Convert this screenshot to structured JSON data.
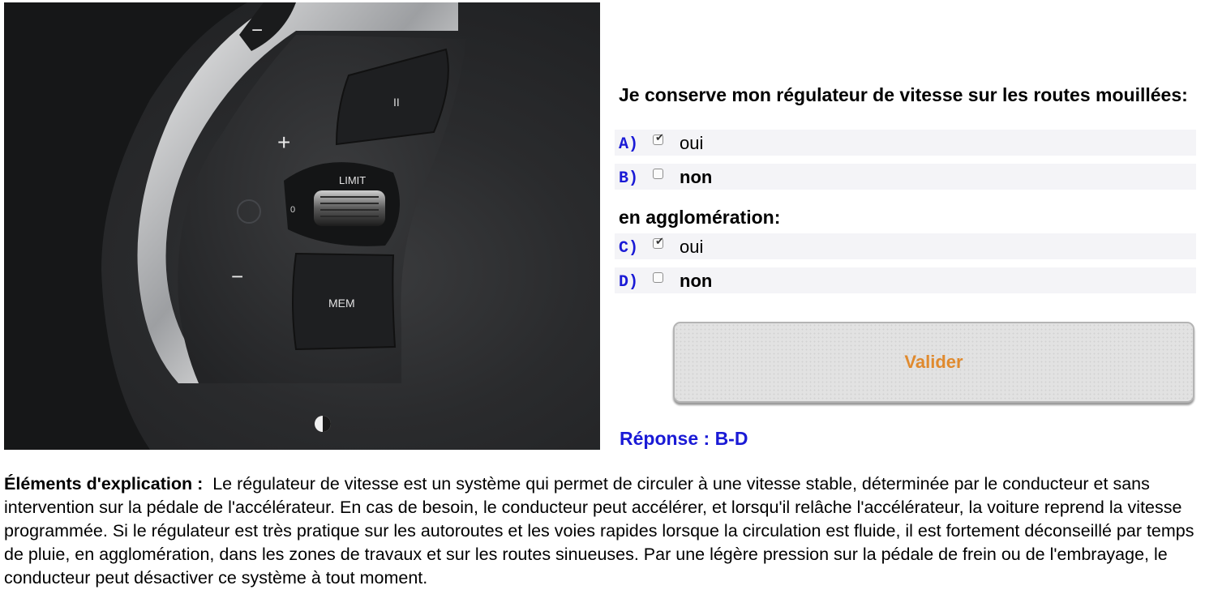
{
  "photo": {
    "image_text": {
      "limit": "LIMIT",
      "mem": "MEM",
      "zero": "0",
      "plus": "+",
      "minus_left": "−",
      "minus_top": "−",
      "pause": "II"
    }
  },
  "question": {
    "title": "Je conserve mon régulateur de vitesse sur les routes mouillées:",
    "subtitle": "en agglomération:",
    "options": [
      {
        "letter": "A)",
        "label": "oui",
        "checked": true
      },
      {
        "letter": "B)",
        "label": "non",
        "checked": false
      },
      {
        "letter": "C)",
        "label": "oui",
        "checked": true
      },
      {
        "letter": "D)",
        "label": "non",
        "checked": false
      }
    ],
    "submit_label": "Valider",
    "answer": "Réponse : B-D"
  },
  "explanation": {
    "label": "Éléments d'explication :",
    "text": "Le régulateur de vitesse est un système qui permet de circuler à une vitesse stable, déterminée par le conducteur et sans intervention sur la pédale de l'accélérateur. En cas de besoin, le conducteur peut accélérer, et lorsqu'il relâche l'accélérateur, la voiture reprend la vitesse programmée. Si le régulateur est très pratique sur les autoroutes et les voies rapides lorsque la circulation est fluide, il est fortement déconseillé par temps de pluie, en agglomération, dans les zones de travaux et sur les routes sinueuses. Par une légère pression sur la pédale de frein ou de l'embrayage, le conducteur peut désactiver ce système à tout moment."
  },
  "colors": {
    "option_letter": "#1a1ad6",
    "answer": "#1a1ad6",
    "button_text": "#e08a2e",
    "option_row_bg": "#f4f4f7"
  }
}
